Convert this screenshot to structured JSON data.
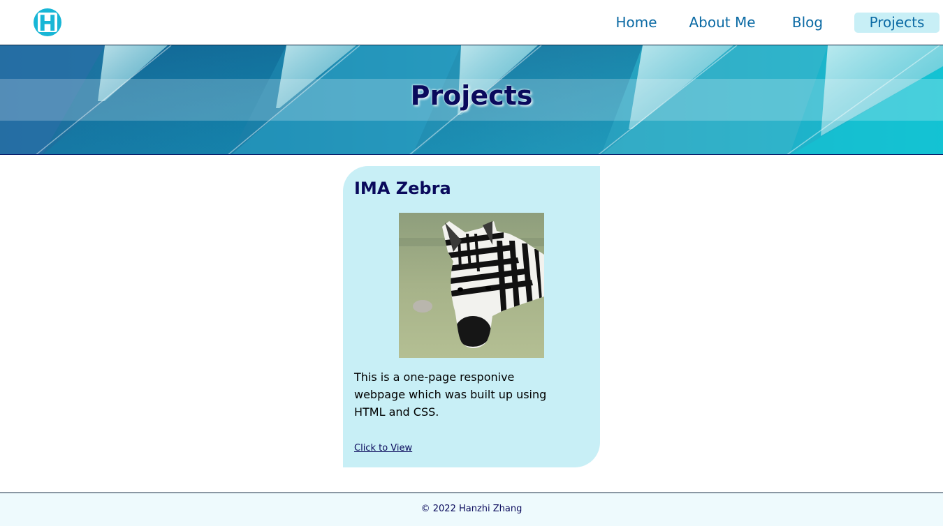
{
  "header": {
    "logo_letter": "H",
    "nav": [
      {
        "label": "Home"
      },
      {
        "label": "About Me"
      },
      {
        "label": "Blog"
      },
      {
        "label": "Projects",
        "active": true
      }
    ]
  },
  "banner": {
    "title": "Projects"
  },
  "project": {
    "title": "IMA Zebra",
    "image_icon": "zebra-image",
    "description": "This is a one-page responive webpage which was built up using HTML and CSS.",
    "link_label": "Click to View"
  },
  "footer": {
    "copyright": "© 2022 Hanzhi Zhang"
  },
  "colors": {
    "brand_cyan": "#18b6d6",
    "nav_text": "#0b6aa4",
    "active_nav_bg": "#c8eff6",
    "card_bg": "#c8eff6",
    "title_navy": "#0a0a5c",
    "footer_bg": "#eefafd"
  }
}
